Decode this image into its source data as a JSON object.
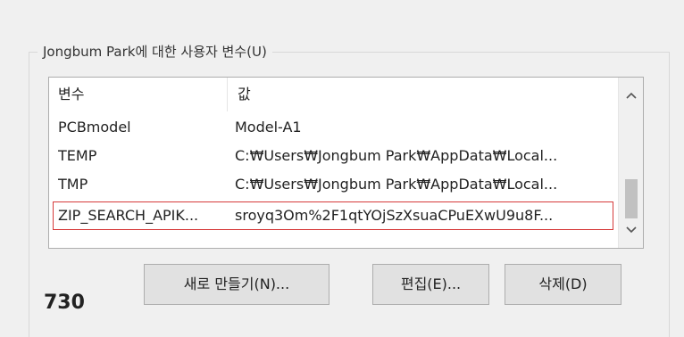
{
  "group": {
    "label": "Jongbum Park에 대한 사용자 변수(U)"
  },
  "table": {
    "headers": [
      "변수",
      "값"
    ],
    "rows": [
      {
        "name": "PCBmodel",
        "value": "Model-A1"
      },
      {
        "name": "TEMP",
        "value": "C:₩Users₩Jongbum Park₩AppData₩Local..."
      },
      {
        "name": "TMP",
        "value": "C:₩Users₩Jongbum Park₩AppData₩Local..."
      },
      {
        "name": "ZIP_SEARCH_APIK...",
        "value": "sroyq3Om%2F1qtYOjSzXsuaCPuEXwU9u8F..."
      }
    ],
    "selected_row_index": 3,
    "highlight_color": "#d63a3a"
  },
  "buttons": {
    "new_label": "새로 만들기(N)...",
    "edit_label": "편집(E)...",
    "delete_label": "삭제(D)"
  },
  "footer": {
    "count": "730"
  },
  "icons": {
    "scroll_up": "chevron-up-icon",
    "scroll_down": "chevron-down-icon"
  }
}
